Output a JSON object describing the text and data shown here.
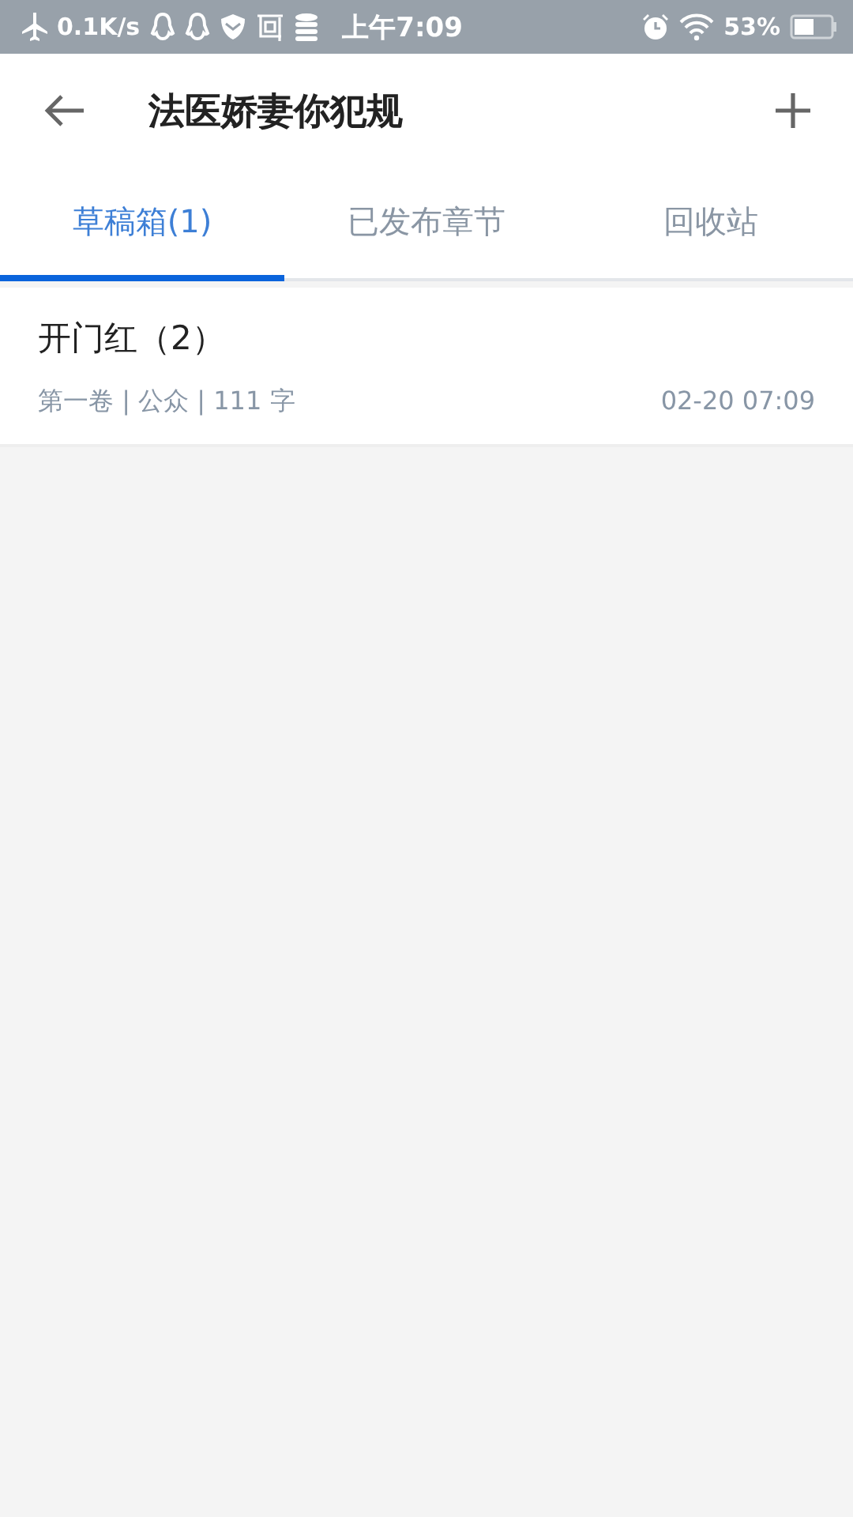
{
  "status_bar": {
    "speed": "0.1K/s",
    "time": "上午7:09",
    "battery": "53%"
  },
  "header": {
    "title": "法医娇妻你犯规"
  },
  "tabs": [
    {
      "label": "草稿箱(1)",
      "selected": true
    },
    {
      "label": "已发布章节",
      "selected": false
    },
    {
      "label": "回收站",
      "selected": false
    }
  ],
  "drafts": [
    {
      "title": "开门红（2）",
      "meta": "第一卷 | 公众 | 111 字",
      "time": "02-20 07:09"
    }
  ]
}
